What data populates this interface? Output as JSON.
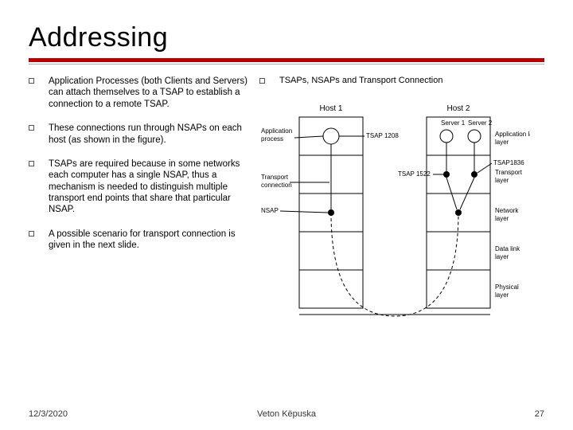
{
  "title": "Addressing",
  "bullets": [
    "Application Processes (both Clients and Servers) can attach themselves to a TSAP to establish a connection to a remote TSAP.",
    "These connections run through NSAPs on each host (as shown in the figure).",
    "TSAPs are required because in some networks each computer has a single NSAP, thus a mechanism is needed to distinguish multiple transport end points that share that particular NSAP.",
    "A possible scenario for transport connection is given in the next slide."
  ],
  "figure_caption": "TSAPs, NSAPs and Transport Connection",
  "figure": {
    "hosts": [
      "Host 1",
      "Host 2"
    ],
    "layers": [
      "Application layer",
      "Transport layer",
      "Network layer",
      "Data link layer",
      "Physical layer"
    ],
    "left_labels": {
      "app_process": "Application process",
      "transport_conn": "Transport connection",
      "nsap": "NSAP"
    },
    "tsaps": {
      "host1_app": "TSAP 1208",
      "host2_transport": "TSAP 1522",
      "host2_server2": "TSAP1836"
    },
    "servers": [
      "Server 1",
      "Server 2"
    ]
  },
  "footer": {
    "date": "12/3/2020",
    "author": "Veton Këpuska",
    "page": "27"
  }
}
